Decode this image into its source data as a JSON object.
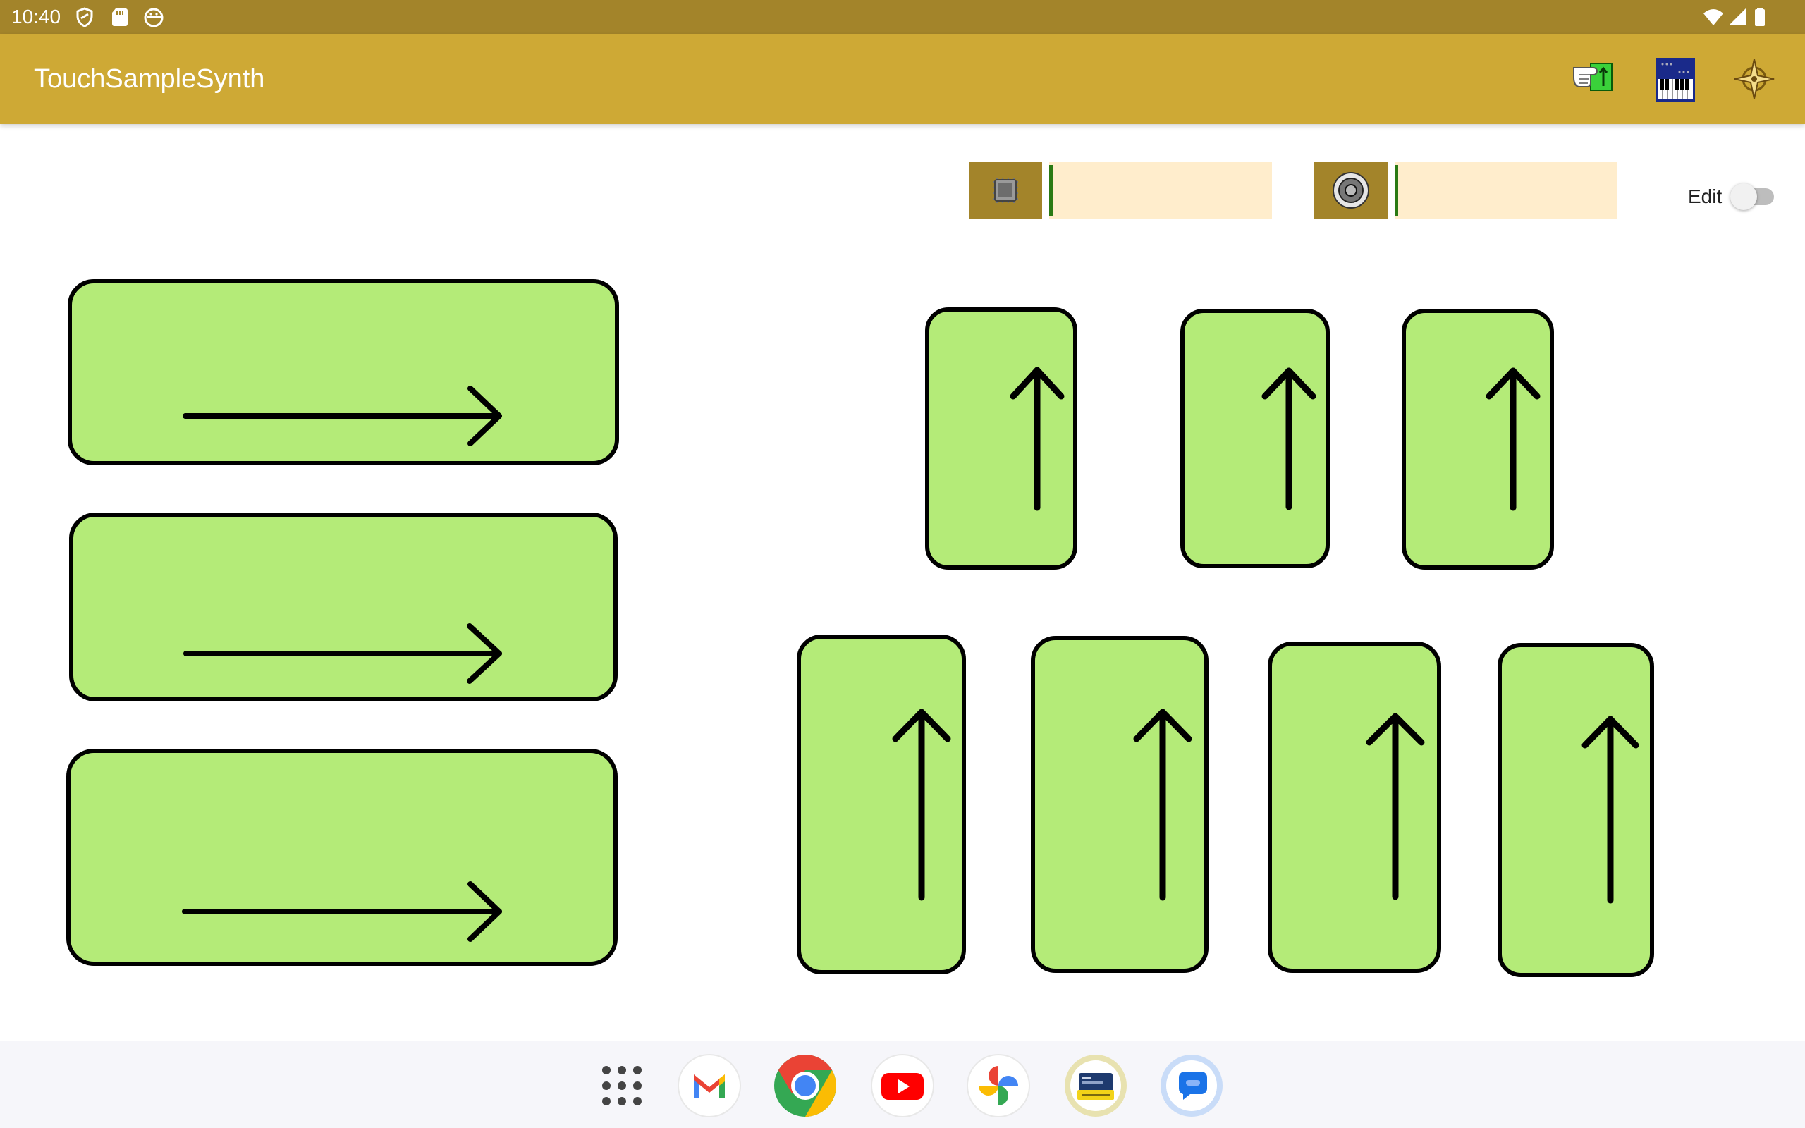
{
  "status_bar": {
    "time": "10:40",
    "left_icons": [
      "vpn-shield-icon",
      "sd-card-icon",
      "android-face-icon"
    ],
    "right_icons": [
      "wifi-icon",
      "cell-signal-icon",
      "battery-icon"
    ]
  },
  "app_bar": {
    "title": "TouchSampleSynth",
    "actions": [
      "touch-pad-icon",
      "piano-keyboard-icon",
      "compass-settings-icon"
    ]
  },
  "meters": [
    {
      "icon": "cpu-chip-icon",
      "level": 0.0
    },
    {
      "icon": "speaker-icon",
      "level": 0.0
    }
  ],
  "edit_toggle": {
    "label": "Edit",
    "on": false
  },
  "pads": {
    "horizontal": [
      {
        "direction": "right"
      },
      {
        "direction": "right"
      },
      {
        "direction": "right"
      }
    ],
    "vertical_top": [
      {
        "direction": "up"
      },
      {
        "direction": "up"
      },
      {
        "direction": "up"
      }
    ],
    "vertical_bottom": [
      {
        "direction": "up"
      },
      {
        "direction": "up"
      },
      {
        "direction": "up"
      },
      {
        "direction": "up"
      }
    ]
  },
  "taskbar": {
    "apps": [
      "app-drawer-icon",
      "gmail-icon",
      "chrome-icon",
      "youtube-icon",
      "photos-icon",
      "wallet-app-icon",
      "messages-icon"
    ]
  },
  "colors": {
    "status_bar": "#a3842a",
    "app_bar": "#cea935",
    "pad_fill": "#b4eb78",
    "meter_track": "#ffedcc",
    "meter_level": "#2a7a14"
  }
}
